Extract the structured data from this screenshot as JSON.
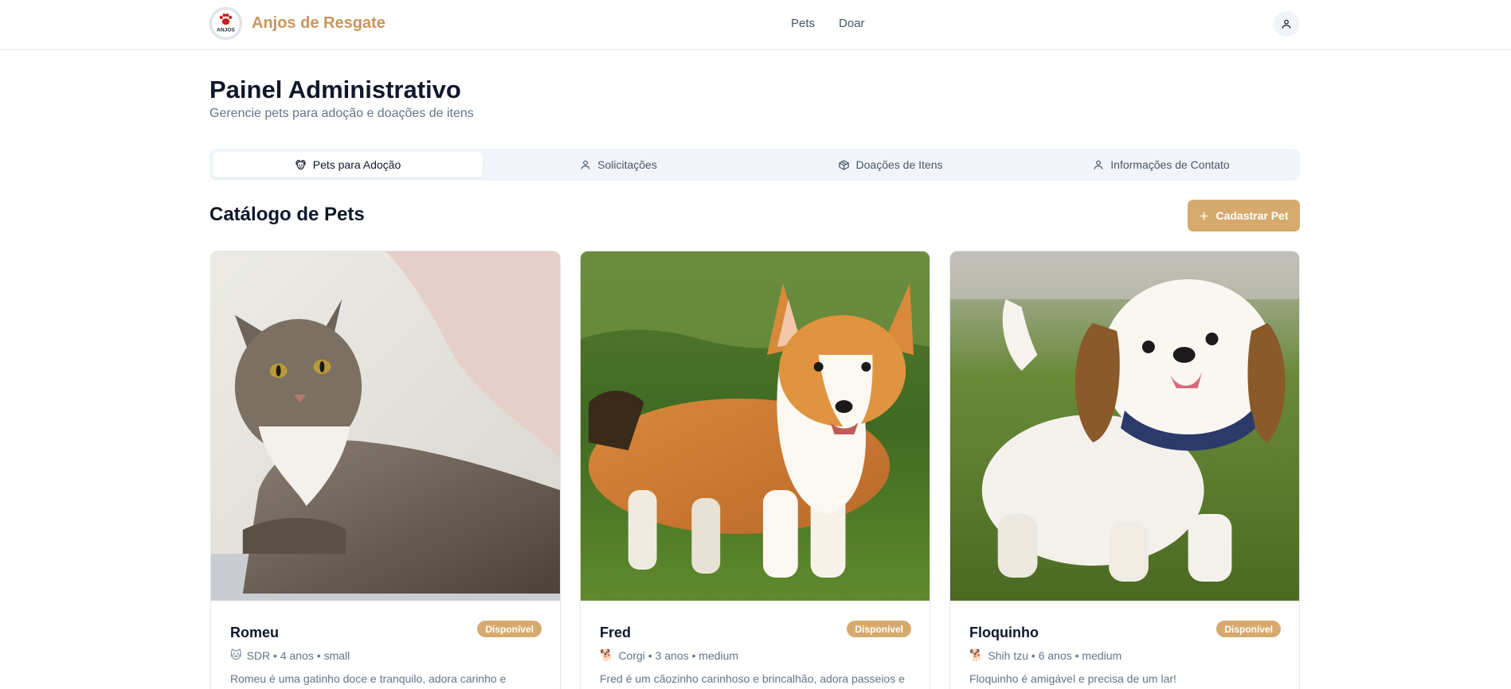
{
  "header": {
    "brand": "Anjos de Resgate",
    "logo_text": "ANJOS",
    "nav": [
      "Pets",
      "Doar"
    ]
  },
  "page": {
    "title": "Painel Administrativo",
    "subtitle": "Gerencie pets para adoção e doações de itens"
  },
  "tabs": [
    {
      "label": "Pets para Adoção",
      "icon": "dog-icon",
      "active": true
    },
    {
      "label": "Solicitações",
      "icon": "user-icon",
      "active": false
    },
    {
      "label": "Doações de Itens",
      "icon": "package-icon",
      "active": false
    },
    {
      "label": "Informações de Contato",
      "icon": "user-icon",
      "active": false
    }
  ],
  "catalog": {
    "title": "Catálogo de Pets",
    "add_label": "Cadastrar Pet"
  },
  "pets": [
    {
      "name": "Romeu",
      "status": "Disponível",
      "emoji": "🐱",
      "meta": "SDR • 4 anos • small",
      "description": "Romeu é uma gatinho doce e tranquilo, adora carinho e"
    },
    {
      "name": "Fred",
      "status": "Disponível",
      "emoji": "🐕",
      "meta": "Corgi • 3 anos • medium",
      "description": "Fred é um cãozinho carinhoso e brincalhão, adora passeios e"
    },
    {
      "name": "Floquinho",
      "status": "Disponível",
      "emoji": "🐕",
      "meta": "Shih tzu • 6 anos • medium",
      "description": "Floquinho é amigável e precisa de um lar!"
    }
  ],
  "colors": {
    "accent": "#d6aa6e",
    "brand": "#c9955a"
  }
}
